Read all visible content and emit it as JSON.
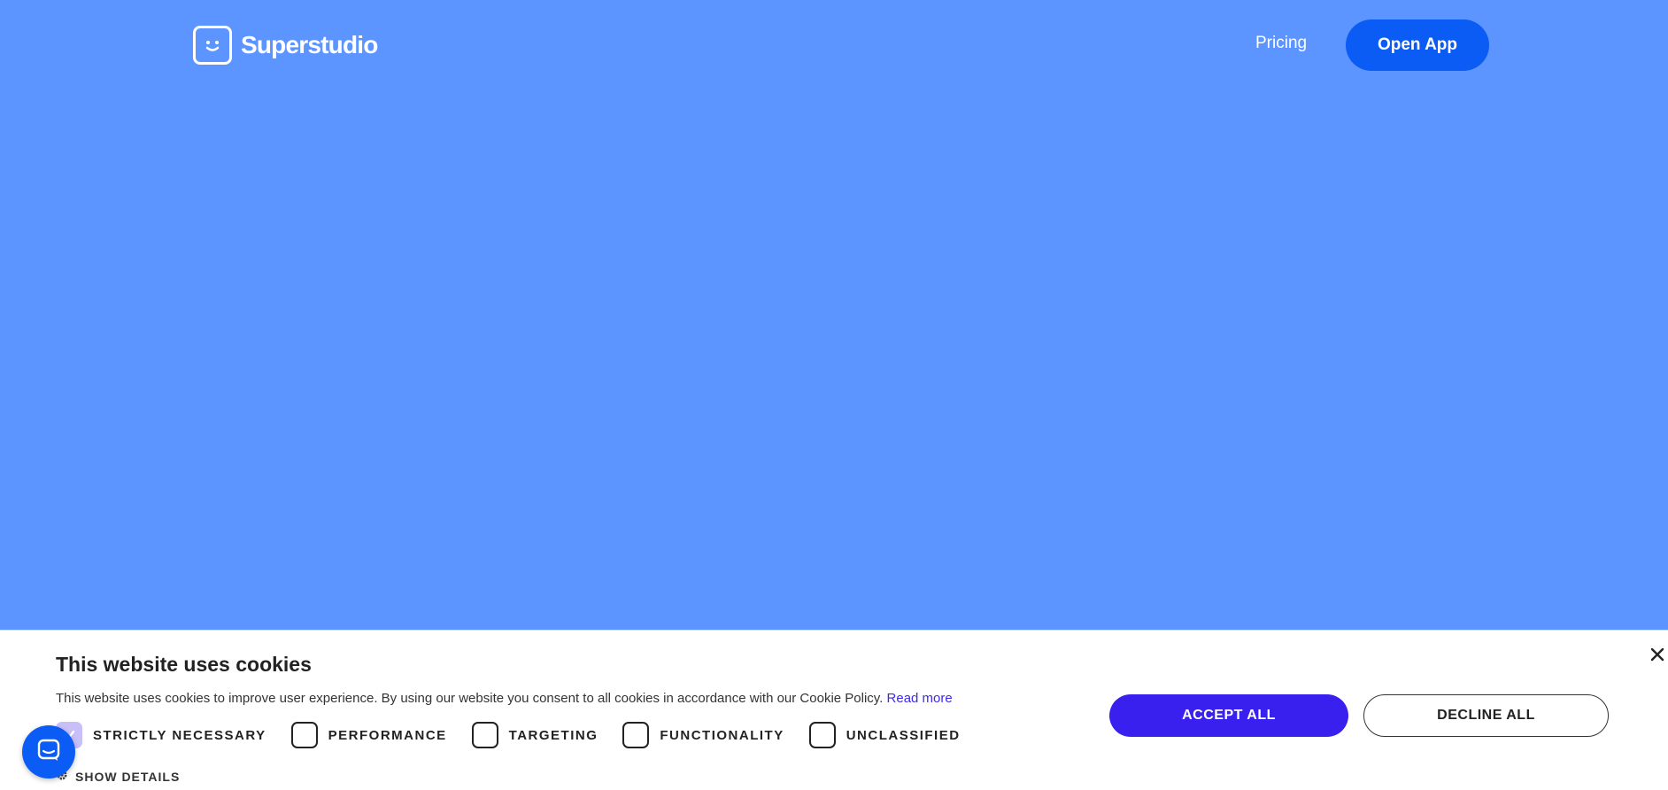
{
  "header": {
    "brand": "Superstudio",
    "nav_pricing": "Pricing",
    "open_app": "Open App"
  },
  "cookie": {
    "title": "This website uses cookies",
    "description": "This website uses cookies to improve user experience. By using our website you consent to all cookies in accordance with our Cookie Policy.",
    "read_more": "Read more",
    "categories": [
      {
        "label": "STRICTLY NECESSARY",
        "checked": true
      },
      {
        "label": "PERFORMANCE",
        "checked": false
      },
      {
        "label": "TARGETING",
        "checked": false
      },
      {
        "label": "FUNCTIONALITY",
        "checked": false
      },
      {
        "label": "UNCLASSIFIED",
        "checked": false
      }
    ],
    "show_details": "SHOW DETAILS",
    "accept_all": "ACCEPT ALL",
    "decline_all": "DECLINE ALL"
  },
  "icons": {
    "logo": "smiley-face-icon",
    "close": "close-icon",
    "gear": "gear-icon",
    "chat": "chat-icon"
  },
  "colors": {
    "background": "#5c95ff",
    "primary_button": "#0a5cf5",
    "accept_button": "#3a20ee",
    "link": "#3e2ae8"
  }
}
